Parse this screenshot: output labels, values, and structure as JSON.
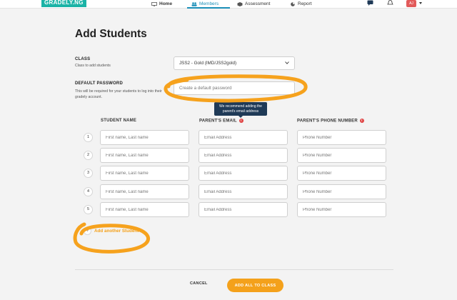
{
  "app": {
    "logo": "GRADELY.NG"
  },
  "nav": {
    "items": [
      {
        "label": "Home",
        "icon": "monitor-icon"
      },
      {
        "label": "Members",
        "icon": "members-icon"
      },
      {
        "label": "Assessment",
        "icon": "assessment-icon"
      },
      {
        "label": "Report",
        "icon": "report-icon"
      }
    ],
    "active": "Members",
    "avatar_initials": "AJ"
  },
  "page": {
    "title": "Add Students"
  },
  "class_section": {
    "label": "CLASS",
    "sublabel": "Class to add students",
    "selected": "JSS2 - Gold (IMD/JSS2gold)"
  },
  "password_section": {
    "label": "DEFAULT PASSWORD",
    "sublabel": "This will be required for your students to log into their gradely account.",
    "placeholder": "Create a default password"
  },
  "tooltip": {
    "text": "We recommend adding the parent's email address"
  },
  "table": {
    "headers": [
      "STUDENT NAME",
      "PARENT'S EMAIL",
      "PARENT'S PHONE NUMBER"
    ],
    "rows": [
      {
        "num": "1",
        "name_ph": "First name, Last name",
        "email_ph": "Email Address",
        "phone_ph": "Phone Number"
      },
      {
        "num": "2",
        "name_ph": "First name, Last name",
        "email_ph": "Email Address",
        "phone_ph": "Phone Number"
      },
      {
        "num": "3",
        "name_ph": "First name, Last name",
        "email_ph": "Email Address",
        "phone_ph": "Phone Number"
      },
      {
        "num": "4",
        "name_ph": "First name, Last name",
        "email_ph": "Email Address",
        "phone_ph": "Phone Number"
      },
      {
        "num": "5",
        "name_ph": "First name, Last name",
        "email_ph": "Email Address",
        "phone_ph": "Phone Number"
      }
    ]
  },
  "add_another": {
    "plus": "+",
    "label": "Add another Student"
  },
  "footer": {
    "cancel": "CANCEL",
    "submit": "ADD ALL TO CLASS"
  },
  "colors": {
    "brand": "#1bb3a6",
    "accent": "#f4a11b",
    "nav_active": "#1b8fb8",
    "tooltip_bg": "#1f3a57",
    "info": "#e04646"
  }
}
